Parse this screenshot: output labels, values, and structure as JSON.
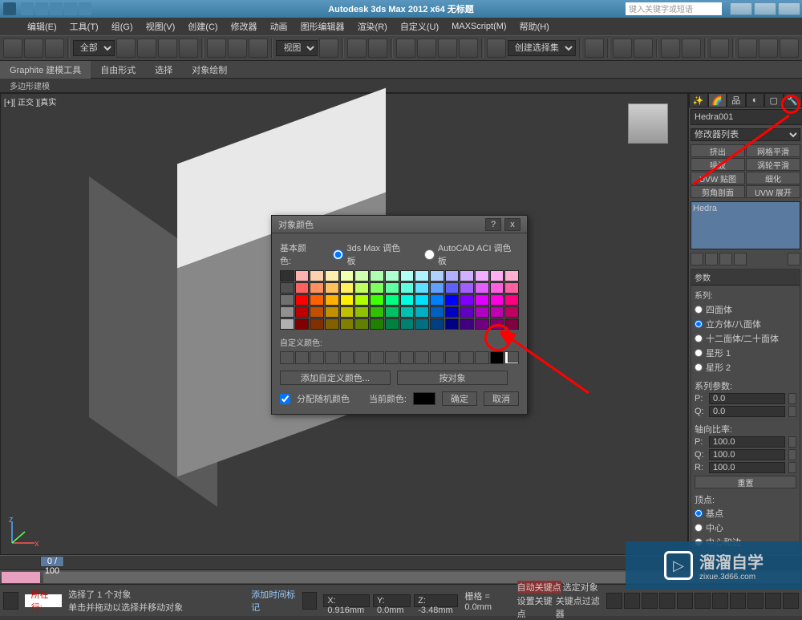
{
  "app": {
    "title": "Autodesk 3ds Max 2012 x64   无标题",
    "search_placeholder": "键入关键字或短语"
  },
  "menu": [
    "编辑(E)",
    "工具(T)",
    "组(G)",
    "视图(V)",
    "创建(C)",
    "修改器",
    "动画",
    "图形编辑器",
    "渲染(R)",
    "自定义(U)",
    "MAXScript(M)",
    "帮助(H)"
  ],
  "toolbar": {
    "layer_dropdown": "全部",
    "view_dropdown": "视图",
    "selset_dropdown": "创建选择集"
  },
  "ribbon": {
    "tabs": [
      "Graphite 建模工具",
      "自由形式",
      "选择",
      "对象绘制"
    ],
    "sub": "多边形建模"
  },
  "viewport": {
    "label": "[+][ 正交 ][真实"
  },
  "cmdpanel": {
    "object_name": "Hedra001",
    "modifier_dropdown": "修改器列表",
    "mod_buttons": [
      "挤出",
      "网格平滑",
      "噪波",
      "涡轮平滑",
      "UVW 贴图",
      "细化",
      "剪角剖面",
      "UVW 展开"
    ],
    "stack_item": "Hedra",
    "rollout_params": "参数",
    "family": {
      "heading": "系列:",
      "options": [
        "四面体",
        "立方体/八面体",
        "十二面体/二十面体",
        "星形 1",
        "星形 2"
      ]
    },
    "family_params": {
      "heading": "系列参数:",
      "p_label": "P:",
      "p_val": "0.0",
      "q_label": "Q:",
      "q_val": "0.0"
    },
    "axis_ratio": {
      "heading": "轴向比率:",
      "p_label": "P:",
      "p_val": "100.0",
      "q_label": "Q:",
      "q_val": "100.0",
      "r_label": "R:",
      "r_val": "100.0",
      "reset": "重置"
    },
    "vertex": {
      "heading": "顶点:",
      "options": [
        "基点",
        "中心",
        "中心和边"
      ]
    }
  },
  "dialog": {
    "title": "对象颜色",
    "basic_colors": "基本颜色:",
    "palette_3dsmax": "3ds Max 调色板",
    "palette_acad": "AutoCAD ACI 调色板",
    "custom_colors": "自定义颜色:",
    "add_custom": "添加自定义颜色...",
    "by_object": "按对象",
    "assign_random": "分配随机颜色",
    "current_color": "当前颜色:",
    "ok": "确定",
    "cancel": "取消",
    "palette_colors": [
      "#303030",
      "#ffb0b0",
      "#ffd0b0",
      "#fff0b0",
      "#f0ffb0",
      "#d0ffb0",
      "#b0ffb0",
      "#b0ffd0",
      "#b0fff0",
      "#b0f0ff",
      "#b0d0ff",
      "#b0b0ff",
      "#d0b0ff",
      "#f0b0ff",
      "#ffb0f0",
      "#ffb0d0",
      "#505050",
      "#ff6060",
      "#ff9060",
      "#ffc060",
      "#fff060",
      "#c0ff60",
      "#80ff60",
      "#60ffa0",
      "#60ffe0",
      "#60e0ff",
      "#60a0ff",
      "#6060ff",
      "#a060ff",
      "#e060ff",
      "#ff60e0",
      "#ff60a0",
      "#707070",
      "#ff0000",
      "#ff6000",
      "#ffb000",
      "#fff000",
      "#b0ff00",
      "#40ff00",
      "#00ff80",
      "#00ffe0",
      "#00e0ff",
      "#0080ff",
      "#0000ff",
      "#8000ff",
      "#e000ff",
      "#ff00e0",
      "#ff0080",
      "#909090",
      "#c00000",
      "#c05000",
      "#c09000",
      "#c0c000",
      "#90c000",
      "#30c000",
      "#00c060",
      "#00c0b0",
      "#00b0c0",
      "#0060c0",
      "#0000c0",
      "#6000c0",
      "#b000c0",
      "#c000b0",
      "#c00060",
      "#b0b0b0",
      "#800000",
      "#803000",
      "#806000",
      "#808000",
      "#608000",
      "#208000",
      "#008040",
      "#008070",
      "#007080",
      "#004080",
      "#000080",
      "#400080",
      "#700080",
      "#800070",
      "#800040"
    ],
    "help_glyph": "?",
    "close_glyph": "x"
  },
  "timeline": {
    "marker": "0 / 100"
  },
  "status": {
    "prompt_label": "所在行:",
    "msg1": "选择了 1 个对象",
    "msg2": "单击并拖动以选择并移动对象",
    "x": "X: 0.916mm",
    "y": "Y: 0.0mm",
    "z": "Z: -3.48mm",
    "grid": "栅格 = 0.0mm",
    "autokey": "自动关键点",
    "selkey": "选定对象",
    "setkey": "设置关键点",
    "keyfilter": "关键点过滤器",
    "addtime": "添加时间标记"
  },
  "watermark": {
    "brand": "溜溜自学",
    "url": "zixue.3d66.com",
    "play": "▷"
  }
}
